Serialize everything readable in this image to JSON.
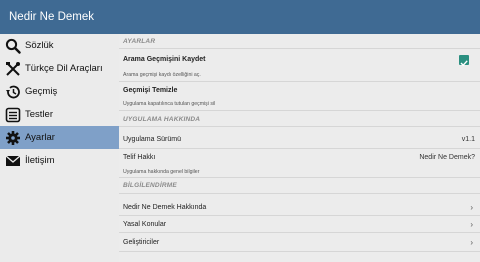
{
  "app": {
    "title": "Nedir Ne Demek"
  },
  "sidebar": {
    "items": [
      {
        "label": "Sözlük",
        "icon": "search-icon"
      },
      {
        "label": "Türkçe Dil Araçları",
        "icon": "tools-icon"
      },
      {
        "label": "Geçmiş",
        "icon": "history-icon"
      },
      {
        "label": "Testler",
        "icon": "list-icon"
      },
      {
        "label": "Ayarlar",
        "icon": "gear-icon",
        "active": true
      },
      {
        "label": "İletişim",
        "icon": "mail-icon"
      }
    ]
  },
  "settings": {
    "section_settings": "AYARLAR",
    "search_history_title": "Arama Geçmişini Kaydet",
    "search_history_sub": "Arama geçmişi kaydı özelliğini aç.",
    "search_history_checked": true,
    "clear_history_title": "Geçmişi Temizle",
    "clear_history_sub": "Uygulama kapatılınca tutulan geçmişi sil",
    "section_about": "UYGULAMA HAKKINDA",
    "version_label": "Uygulama Sürümü",
    "version_value": "v1.1",
    "copyright_label": "Telif Hakkı",
    "copyright_value": "Nedir Ne Demek?",
    "about_sub": "Uygulama hakkında genel bilgiler",
    "section_info": "BİLGİLENDİRME",
    "info_items": [
      "Nedir Ne Demek Hakkında",
      "Yasal Konular",
      "Geliştiriciler"
    ]
  },
  "colors": {
    "appbar": "#3f6a93",
    "active_item": "#7fa0c8",
    "checkbox": "#2b8f80"
  }
}
